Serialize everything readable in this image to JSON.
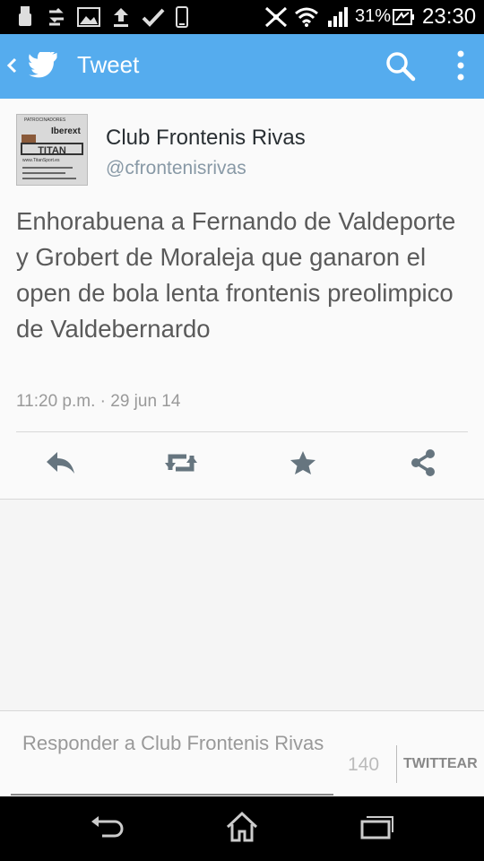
{
  "status_bar": {
    "battery_percent": "31%",
    "time": "23:30",
    "icons": [
      "usb-icon",
      "data-transfer-icon",
      "image-icon",
      "upload-icon",
      "check-icon",
      "phone-icon",
      "nfc-icon",
      "wifi-icon",
      "signal-icon",
      "battery-icon"
    ]
  },
  "app_bar": {
    "title": "Tweet",
    "color": "#55acee",
    "icons": [
      "back-icon",
      "twitter-logo-icon",
      "search-icon",
      "overflow-menu-icon"
    ]
  },
  "tweet": {
    "display_name": "Club Frontenis Rivas",
    "handle": "@cfrontenisrivas",
    "avatar_text": [
      "PATROCINADORES",
      "Iberext",
      "TITAN",
      "www.TitanSport.es"
    ],
    "text": "Enhorabuena a Fernando de Valdeporte y Grobert de Moraleja que ganaron el open de bola lenta frontenis preolimpico de Valdebernardo",
    "timestamp": "11:20 p.m. · 29 jun 14",
    "actions": [
      "reply-icon",
      "retweet-icon",
      "favorite-icon",
      "share-icon"
    ]
  },
  "reply": {
    "placeholder": "Responder a Club Frontenis Rivas",
    "counter": "140",
    "button_label": "TWITTEAR"
  },
  "nav_bar": {
    "icons": [
      "back-nav-icon",
      "home-icon",
      "recent-apps-icon"
    ]
  }
}
